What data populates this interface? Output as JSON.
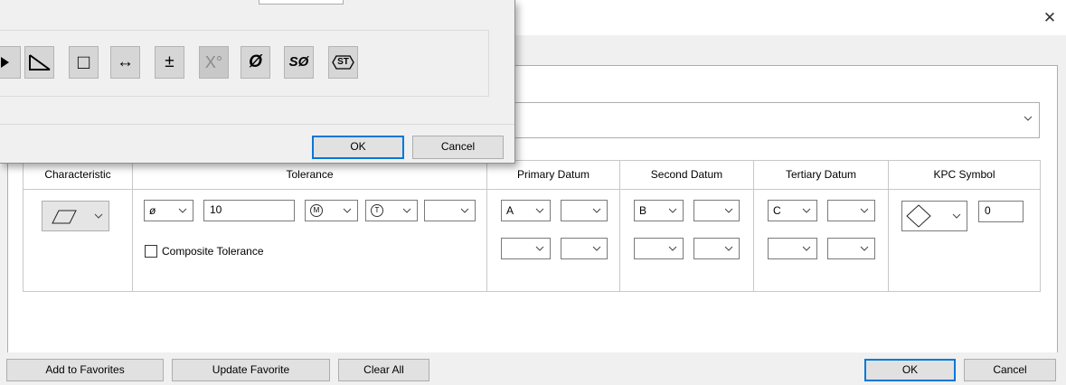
{
  "window": {
    "close_glyph": "✕"
  },
  "top_combo": {
    "value": ""
  },
  "table": {
    "headers": {
      "characteristic": "Characteristic",
      "tolerance": "Tolerance",
      "primary": "Primary Datum",
      "second": "Second Datum",
      "tertiary": "Tertiary Datum",
      "kpc": "KPC Symbol"
    },
    "characteristic": {
      "icon": "parallelogram-flatness-icon"
    },
    "tolerance": {
      "diameter_modifier": "ø",
      "value": "10",
      "material_modifier": "M",
      "tangent_modifier": "T",
      "extra": "",
      "composite_label": "Composite Tolerance",
      "composite_checked": false
    },
    "primary": {
      "datum": "A",
      "modifier": "",
      "row2_datum": "",
      "row2_modifier": ""
    },
    "second": {
      "datum": "B",
      "modifier": "",
      "row2_datum": "",
      "row2_modifier": ""
    },
    "tertiary": {
      "datum": "C",
      "modifier": "",
      "row2_datum": "",
      "row2_modifier": ""
    },
    "kpc": {
      "icon": "diamond-icon",
      "value": "0"
    }
  },
  "buttons": {
    "add_favorites": "Add to Favorites",
    "update_favorite": "Update Favorite",
    "clear_all": "Clear All",
    "ok": "OK",
    "cancel": "Cancel"
  },
  "symbol_dialog": {
    "symbols": [
      {
        "name": "arrow-icon",
        "glyph": ""
      },
      {
        "name": "slope-icon",
        "glyph": ""
      },
      {
        "name": "square-icon",
        "glyph": "□"
      },
      {
        "name": "double-arrow-icon",
        "glyph": "↔"
      },
      {
        "name": "plus-minus-icon",
        "glyph": "±"
      },
      {
        "name": "degree-icon",
        "glyph": "X°"
      },
      {
        "name": "diameter-icon",
        "glyph": "Ø"
      },
      {
        "name": "spherical-diameter-icon",
        "glyph": "SØ"
      },
      {
        "name": "statistical-icon",
        "glyph": "ST"
      }
    ],
    "ok": "OK",
    "cancel": "Cancel"
  },
  "colors": {
    "accent": "#0078d7",
    "face": "#f0f0f0",
    "button": "#e1e1e1"
  }
}
